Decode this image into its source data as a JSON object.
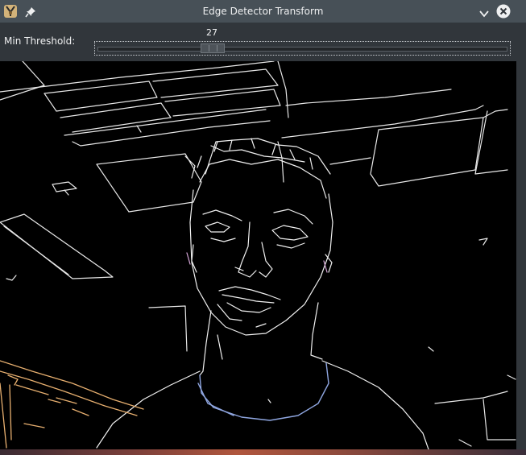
{
  "window": {
    "title": "Edge Detector Transform",
    "icons": {
      "app": "app-icon",
      "pin": "pin-icon",
      "minimize": "chevron-down-icon",
      "close": "close-icon"
    }
  },
  "controls": {
    "threshold_label": "Min Threshold:",
    "threshold_value": "27",
    "threshold_fraction": 0.27
  },
  "colors": {
    "titlebar": "#475057",
    "background": "#31363b",
    "canvas": "#000000"
  }
}
